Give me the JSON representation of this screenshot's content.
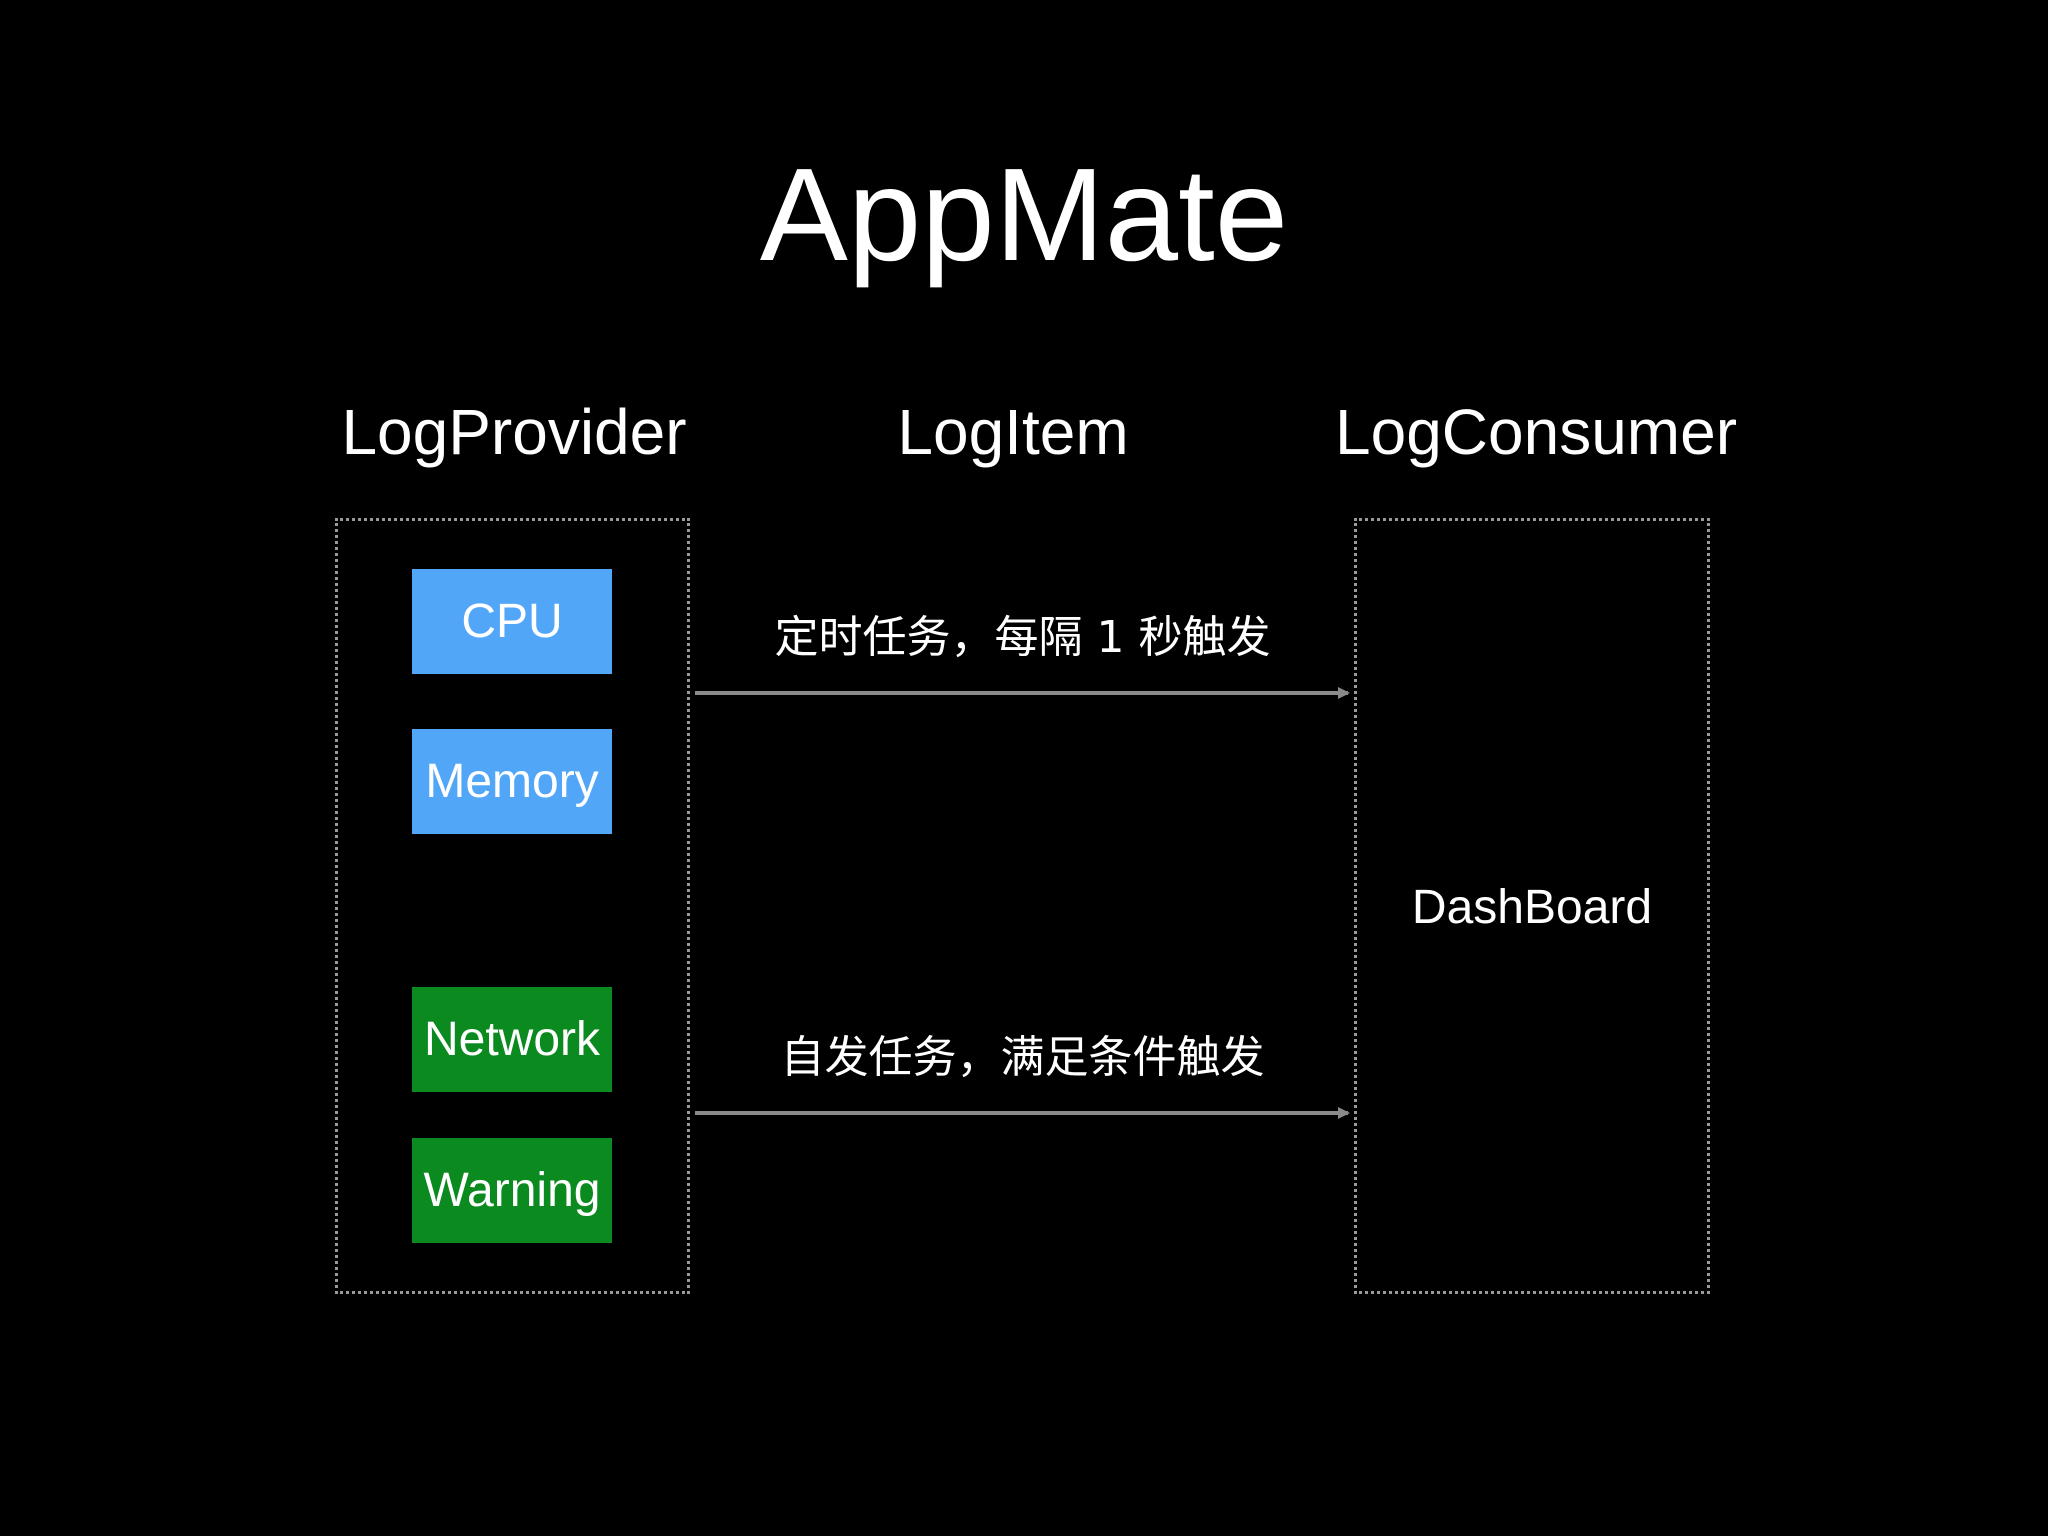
{
  "title": "AppMate",
  "columns": {
    "provider": "LogProvider",
    "item": "LogItem",
    "consumer": "LogConsumer"
  },
  "providers": [
    {
      "label": "CPU",
      "color": "#52a6f7"
    },
    {
      "label": "Memory",
      "color": "#52a6f7"
    },
    {
      "label": "Network",
      "color": "#0b8a1f"
    },
    {
      "label": "Warning",
      "color": "#0b8a1f"
    }
  ],
  "consumer": {
    "label": "DashBoard"
  },
  "arrows": [
    {
      "label": "定时任务，每隔 1 秒触发"
    },
    {
      "label": "自发任务，满足条件触发"
    }
  ],
  "colors": {
    "background": "#000000",
    "text": "#ffffff",
    "border": "#9a9a9a",
    "arrow": "#8a8a8a"
  }
}
